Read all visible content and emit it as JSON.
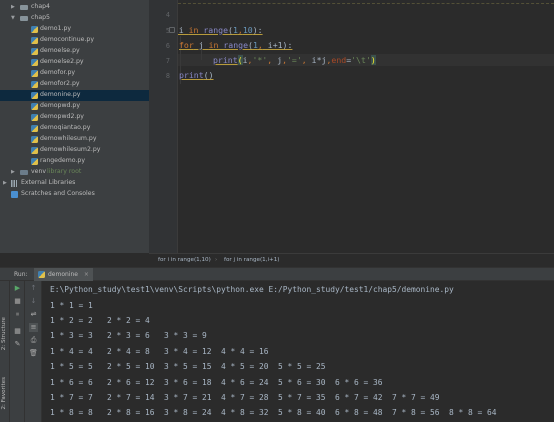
{
  "project_tree": {
    "items": [
      {
        "label": "chap4",
        "type": "folder",
        "expanded": false
      },
      {
        "label": "chap5",
        "type": "folder",
        "expanded": true
      },
      {
        "label": "demo1.py",
        "type": "py"
      },
      {
        "label": "democontinue.py",
        "type": "py"
      },
      {
        "label": "demoelse.py",
        "type": "py"
      },
      {
        "label": "demoelse2.py",
        "type": "py"
      },
      {
        "label": "demofor.py",
        "type": "py"
      },
      {
        "label": "demofor2.py",
        "type": "py"
      },
      {
        "label": "demonine.py",
        "type": "py",
        "selected": true
      },
      {
        "label": "demopwd.py",
        "type": "py"
      },
      {
        "label": "demopwd2.py",
        "type": "py"
      },
      {
        "label": "demoqiantao.py",
        "type": "py"
      },
      {
        "label": "demowhilesum.py",
        "type": "py"
      },
      {
        "label": "demowhilesum2.py",
        "type": "py"
      },
      {
        "label": "rangedemo.py",
        "type": "py"
      },
      {
        "label": "venv",
        "sublabel": "library root",
        "type": "folder",
        "expanded": false
      },
      {
        "label": "External Libraries",
        "type": "lib",
        "expanded": false
      },
      {
        "label": "Scratches and Consoles",
        "type": "scratch"
      }
    ]
  },
  "editor": {
    "line_numbers": [
      "4",
      "5",
      "6",
      "7",
      "8"
    ],
    "code": {
      "l1": {
        "kw_for": "for",
        "var": " i ",
        "kw_in": "in",
        "fn": " range",
        "p1": "(",
        "n1": "1",
        "c1": ",",
        "n2": "10",
        "p2": "):"
      },
      "l2": {
        "kw_for": "for",
        "var": " j ",
        "kw_in": "in",
        "fn": " range",
        "p1": "(",
        "n1": "1",
        "c1": ",",
        "rest": " i+1):"
      },
      "l3": {
        "fn": "print",
        "p1": "(",
        "a1": "i",
        "c1": ",",
        "s1": "'*'",
        "c2": ",",
        "a2": " j",
        "c3": ",",
        "s2": "'='",
        "c4": ",",
        "a3": " i*j",
        "c5": ",",
        "kw": "end",
        "eq": "=",
        "s3": "'\\t'",
        "p2": ")"
      },
      "l4": {
        "fn": "print",
        "rest": "()"
      }
    }
  },
  "breadcrumb": {
    "item1": "for i in range(1,10)",
    "sep": "›",
    "item2": "for j in range(1,i+1)"
  },
  "run_panel": {
    "label": "Run:",
    "tab": "demonine",
    "tab_close": "×",
    "side_labels": {
      "structure": "2: Structure",
      "favorites": "2: Favorites"
    },
    "console": [
      "E:\\Python_study\\test1\\venv\\Scripts\\python.exe E:/Python_study/test1/chap5/demonine.py",
      "1 * 1 = 1",
      "1 * 2 = 2   2 * 2 = 4",
      "1 * 3 = 3   2 * 3 = 6   3 * 3 = 9",
      "1 * 4 = 4   2 * 4 = 8   3 * 4 = 12  4 * 4 = 16",
      "1 * 5 = 5   2 * 5 = 10  3 * 5 = 15  4 * 5 = 20  5 * 5 = 25",
      "1 * 6 = 6   2 * 6 = 12  3 * 6 = 18  4 * 6 = 24  5 * 6 = 30  6 * 6 = 36",
      "1 * 7 = 7   2 * 7 = 14  3 * 7 = 21  4 * 7 = 28  5 * 7 = 35  6 * 7 = 42  7 * 7 = 49",
      "1 * 8 = 8   2 * 8 = 16  3 * 8 = 24  4 * 8 = 32  5 * 8 = 40  6 * 8 = 48  7 * 8 = 56  8 * 8 = 64"
    ]
  },
  "colors": {
    "keyword": "#cc7832",
    "builtin": "#8888c6",
    "number": "#6897bb",
    "string": "#6a8759",
    "selection": "#0d293e"
  }
}
